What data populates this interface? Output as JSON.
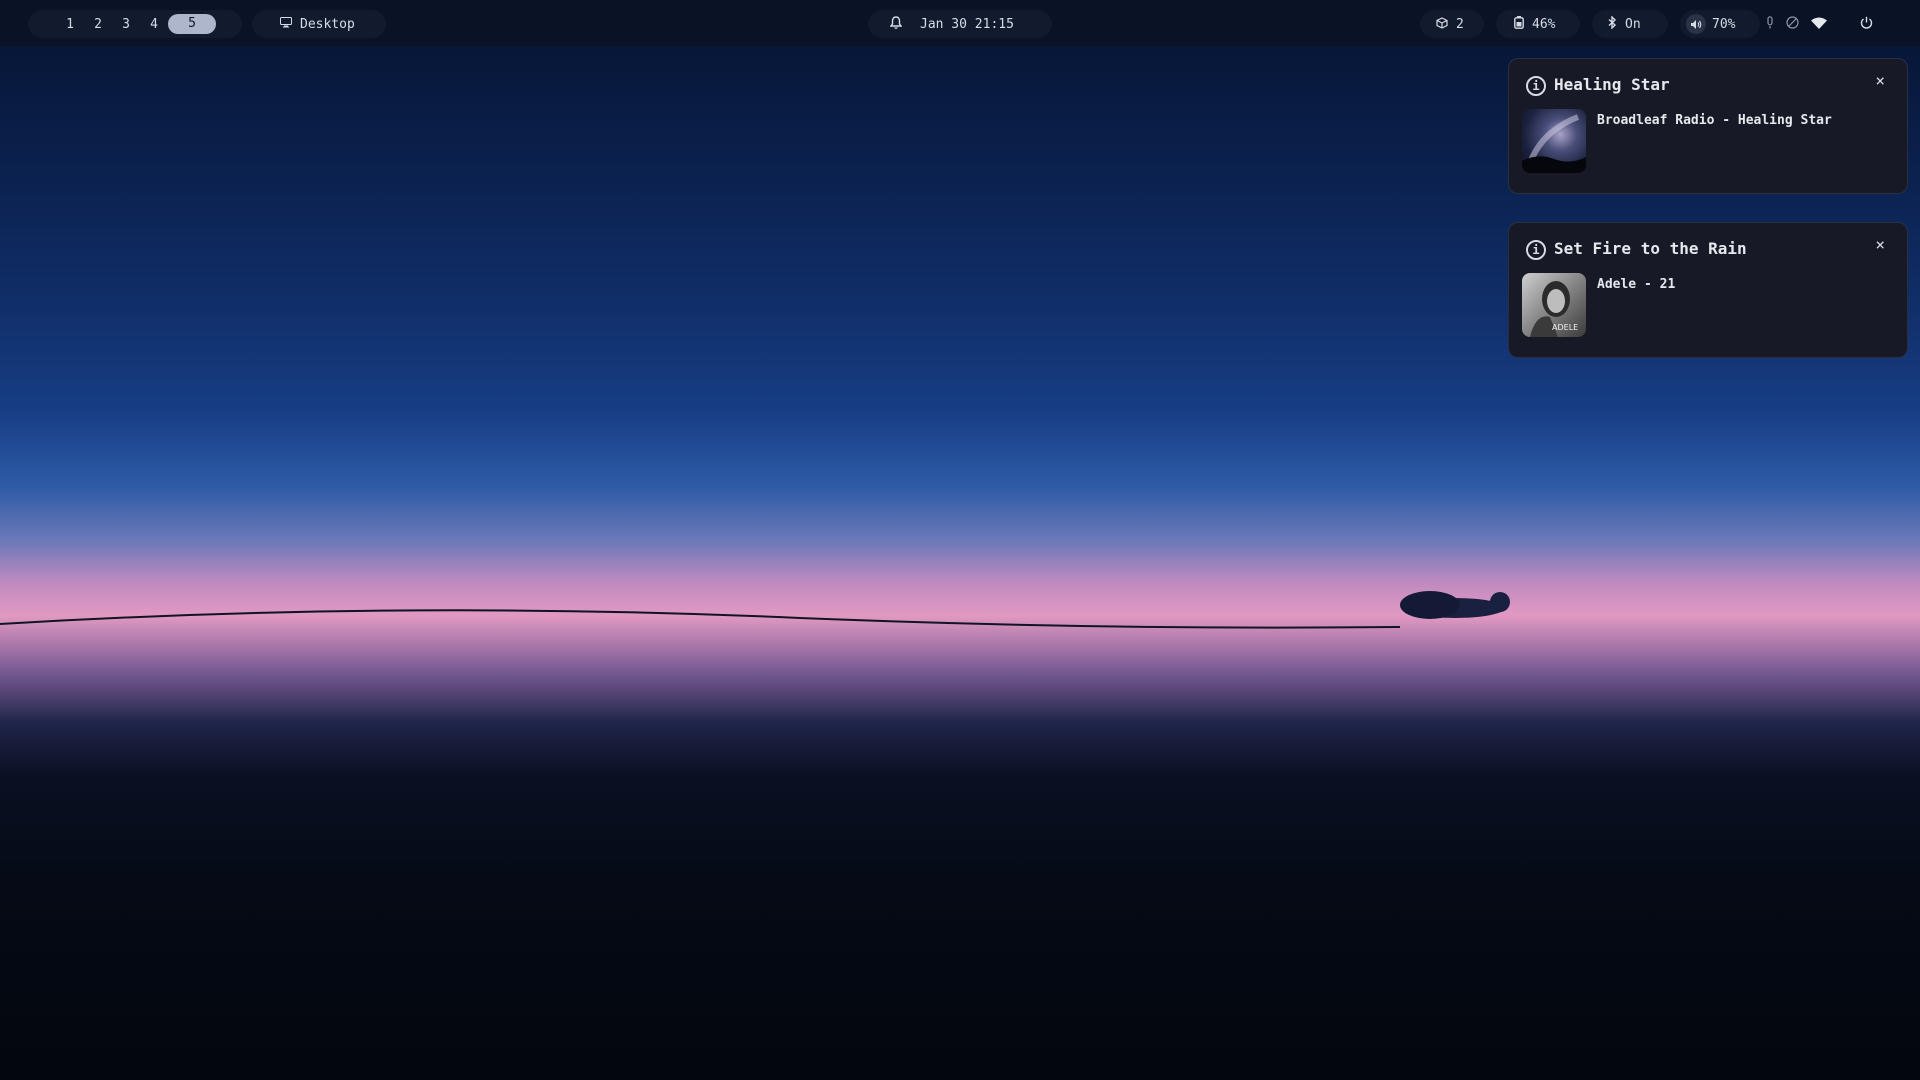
{
  "topbar": {
    "workspaces": [
      "1",
      "2",
      "3",
      "4",
      "5"
    ],
    "active_workspace": "5",
    "window_label": "Desktop",
    "datetime": "Jan 30 21:15",
    "updates_count": "2",
    "battery": "46%",
    "bluetooth": "On",
    "volume": "70%",
    "icons": {
      "window": "monitor-icon",
      "bell": "bell-icon",
      "updates": "package-icon",
      "battery": "battery-icon",
      "bluetooth": "bluetooth-icon",
      "volume": "speaker-icon",
      "microphone": "microphone-icon",
      "dnd": "do-not-disturb-icon",
      "wifi": "wifi-icon",
      "power": "power-icon"
    }
  },
  "notifications": [
    {
      "title": "Healing Star",
      "body": "Broadleaf Radio - Healing Star",
      "icon": "info-icon",
      "close": "×"
    },
    {
      "title": "Set Fire to the Rain",
      "body": "Adele - 21",
      "icon": "info-icon",
      "close": "×",
      "art_text": "ADELE"
    }
  ],
  "colors": {
    "bar_bg": "#0a1326",
    "pill_bg": "#121b2e",
    "notif_bg": "#171a26",
    "active_ws": "#aeb6cc"
  }
}
